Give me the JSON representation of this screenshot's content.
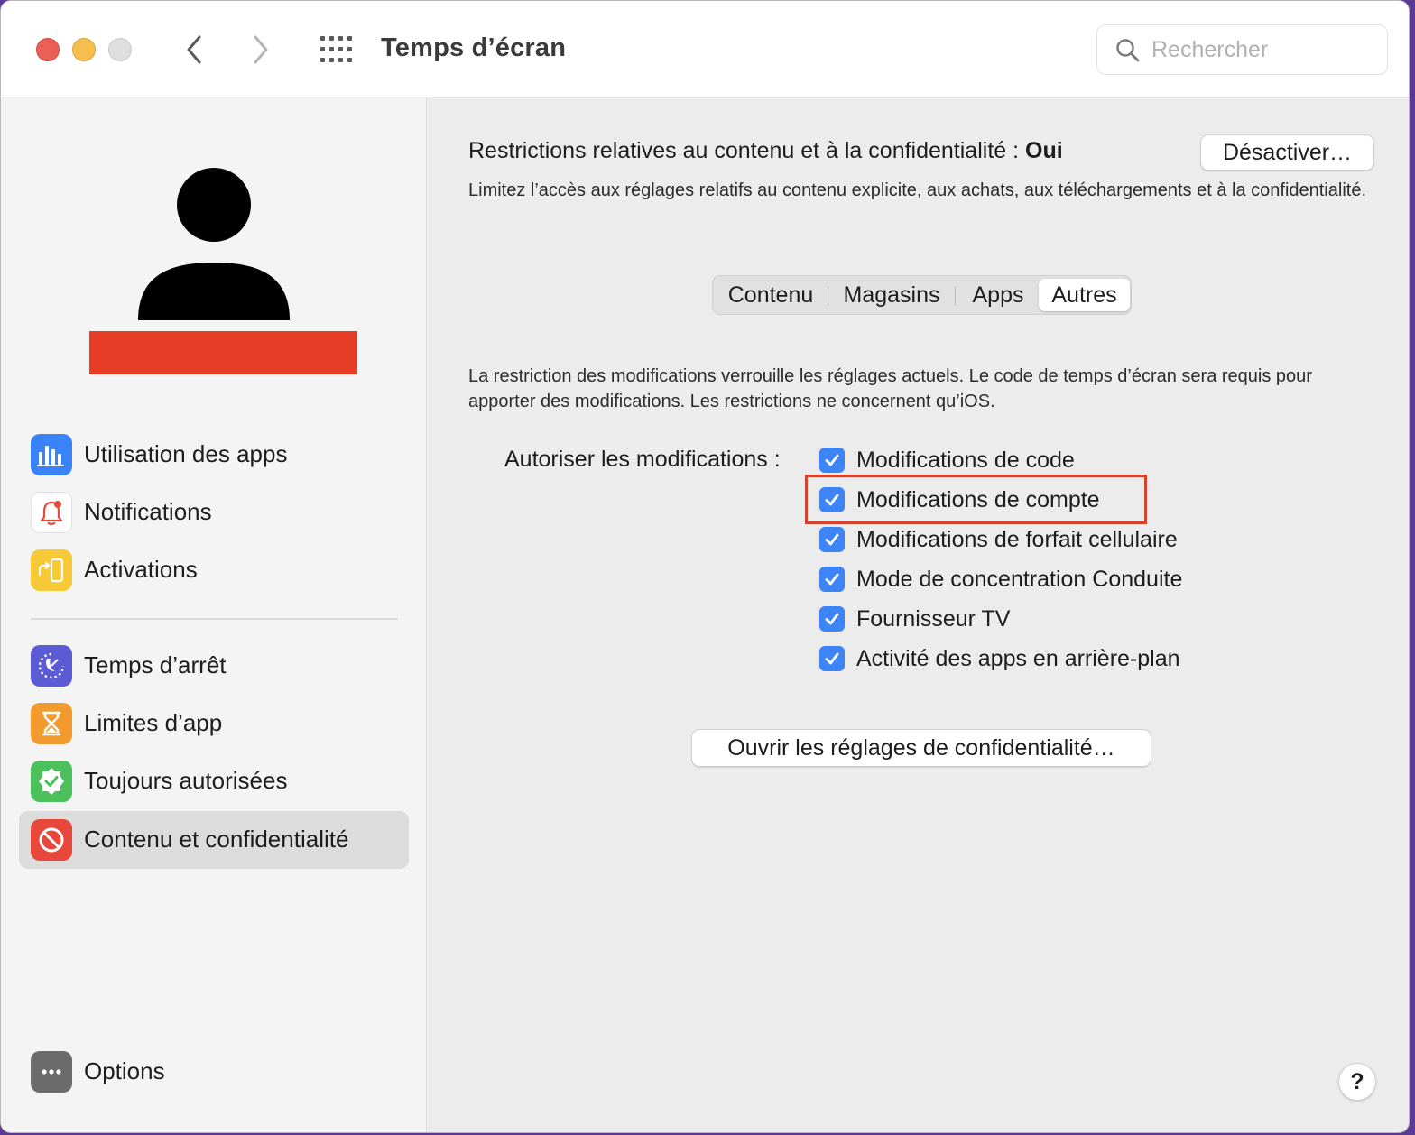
{
  "window": {
    "title": "Temps d’écran",
    "search_placeholder": "Rechercher"
  },
  "sidebar": {
    "items": [
      {
        "label": "Utilisation des apps",
        "icon": "bar-chart-icon",
        "color": "#3a82f7"
      },
      {
        "label": "Notifications",
        "icon": "bell-icon",
        "color": "#e8483c"
      },
      {
        "label": "Activations",
        "icon": "pickup-phone-icon",
        "color": "#f7c937"
      },
      {
        "label": "Temps d’arrêt",
        "icon": "downtime-icon",
        "color": "#5b5bd6"
      },
      {
        "label": "Limites d’app",
        "icon": "hourglass-icon",
        "color": "#f39a2e"
      },
      {
        "label": "Toujours autorisées",
        "icon": "checkmark-badge-icon",
        "color": "#4cc15b"
      },
      {
        "label": "Contenu et confidentialité",
        "icon": "no-entry-icon",
        "color": "#e8483c",
        "selected": true
      }
    ],
    "options_label": "Options"
  },
  "main": {
    "restrictions_label": "Restrictions relatives au contenu et à la confidentialité :",
    "restrictions_state": "Oui",
    "disable_button": "Désactiver…",
    "description": "Limitez l’accès aux réglages relatifs au contenu explicite, aux achats, aux téléchargements et à la confidentialité.",
    "tabs": [
      {
        "label": "Contenu",
        "active": false
      },
      {
        "label": "Magasins",
        "active": false
      },
      {
        "label": "Apps",
        "active": false
      },
      {
        "label": "Autres",
        "active": true
      }
    ],
    "restriction_note": "La restriction des modifications verrouille les réglages actuels. Le code de temps d’écran sera requis pour apporter des modifications. Les restrictions ne concernent qu’iOS.",
    "allow_label": "Autoriser les modifications :",
    "checkboxes": [
      {
        "label": "Modifications de code",
        "checked": true
      },
      {
        "label": "Modifications de compte",
        "checked": true
      },
      {
        "label": "Modifications de forfait cellulaire",
        "checked": true
      },
      {
        "label": "Mode de concentration Conduite",
        "checked": true
      },
      {
        "label": "Fournisseur TV",
        "checked": true
      },
      {
        "label": "Activité des apps en arrière-plan",
        "checked": true
      }
    ],
    "privacy_button": "Ouvrir les réglages de confidentialité…",
    "help_button": "?"
  },
  "colors": {
    "checkbox": "#3d84f7",
    "highlight": "#d9412c",
    "redaction": "#e63e26"
  }
}
